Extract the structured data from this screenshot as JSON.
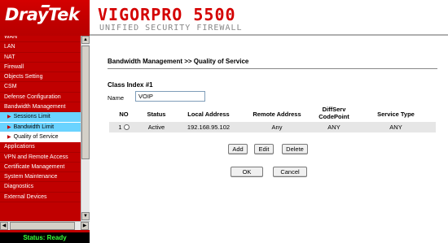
{
  "header": {
    "brand": "DrayTek",
    "product": "VIGORPRO 5500",
    "subtitle": "UNIFIED SECURITY FIREWALL"
  },
  "sidebar": {
    "items": [
      {
        "label": "WAN"
      },
      {
        "label": "LAN"
      },
      {
        "label": "NAT"
      },
      {
        "label": "Firewall"
      },
      {
        "label": "Objects Setting"
      },
      {
        "label": "CSM"
      },
      {
        "label": "Defense Configuration"
      },
      {
        "label": "Bandwidth Management"
      }
    ],
    "sub_items": [
      {
        "label": "Sessions Limit"
      },
      {
        "label": "Bandwidth Limit"
      },
      {
        "label": "Quality of Service"
      }
    ],
    "items_after": [
      {
        "label": "Applications"
      },
      {
        "label": "VPN and Remote Access"
      },
      {
        "label": "Certificate Management"
      },
      {
        "label": "System Maintenance"
      },
      {
        "label": "Diagnostics"
      },
      {
        "label": "External Devices"
      }
    ],
    "status": "Status: Ready"
  },
  "main": {
    "breadcrumb": "Bandwidth Management >> Quality of Service",
    "class_index": "Class Index #1",
    "name_label": "Name",
    "name_value": "VOIP",
    "table": {
      "headers": {
        "no": "NO",
        "status": "Status",
        "local": "Local Address",
        "remote": "Remote Address",
        "diffserv_1": "DiffServ",
        "diffserv_2": "CodePoint",
        "service": "Service Type"
      },
      "row": {
        "no": "1",
        "status": "Active",
        "local": "192.168.95.102",
        "remote": "Any",
        "diffserv": "ANY",
        "service": "ANY"
      }
    },
    "buttons": {
      "add": "Add",
      "edit": "Edit",
      "delete": "Delete",
      "ok": "OK",
      "cancel": "Cancel"
    }
  },
  "colors": {
    "brand_red": "#c00000",
    "submenu_blue": "#6ad3ff",
    "status_green": "#39ff39"
  }
}
